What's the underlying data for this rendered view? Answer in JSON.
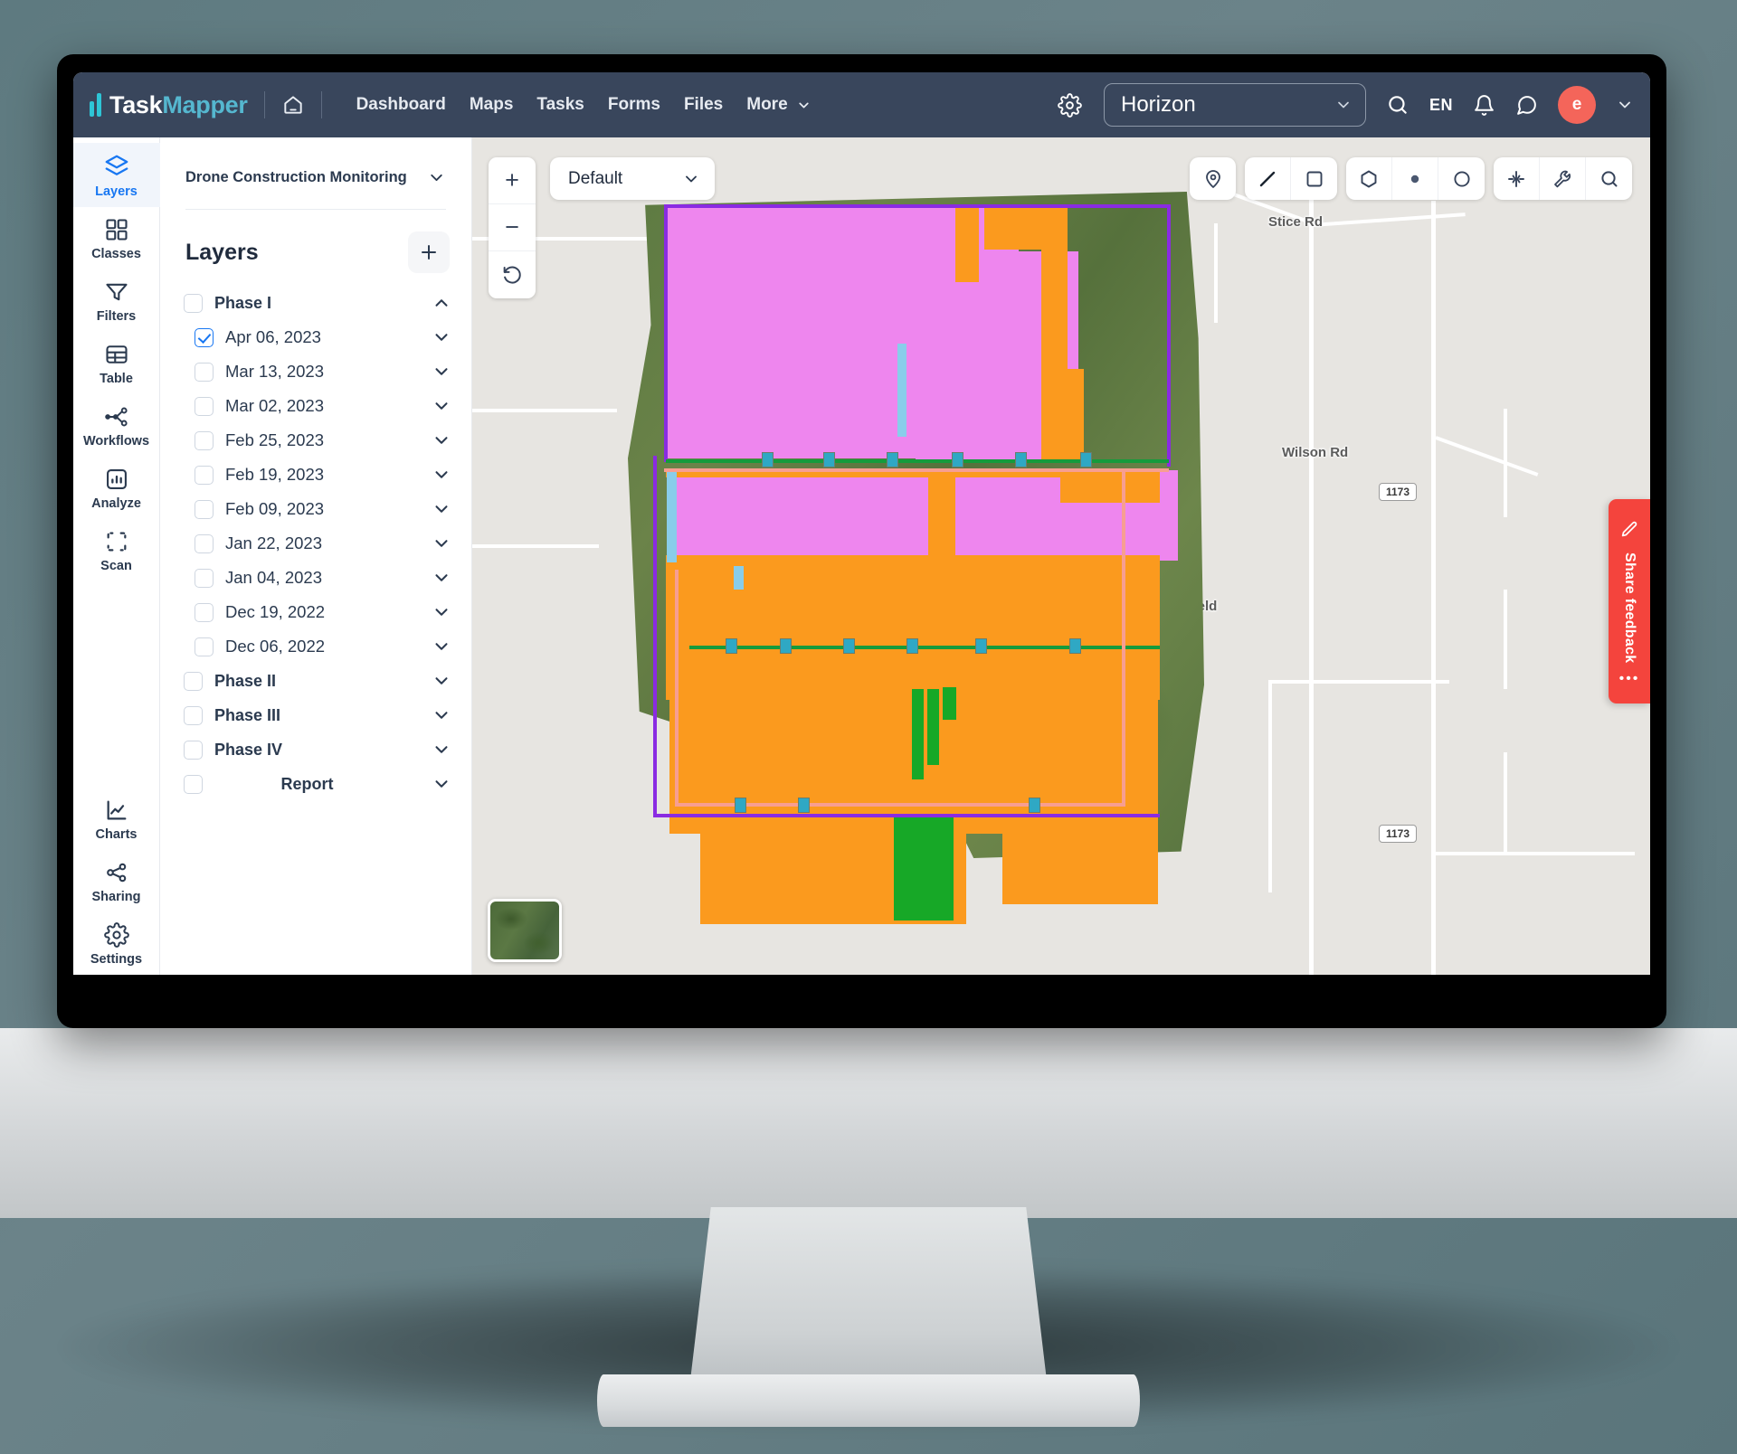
{
  "header": {
    "logo": {
      "primary": "Task",
      "secondary": "Mapper"
    },
    "home_icon": "home-icon",
    "nav": [
      {
        "label": "Dashboard"
      },
      {
        "label": "Maps"
      },
      {
        "label": "Tasks"
      },
      {
        "label": "Forms"
      },
      {
        "label": "Files"
      },
      {
        "label": "More"
      }
    ],
    "gear_icon": "gear-icon",
    "project_select": {
      "value": "Horizon",
      "chevron": "chevron-down-icon"
    },
    "search_icon": "search-icon",
    "language": "EN",
    "bell_icon": "bell-icon",
    "chat_icon": "chat-bubble-icon",
    "avatar": {
      "initial": "e",
      "color": "#f4655a"
    },
    "avatar_chevron": "chevron-down-icon"
  },
  "rail": {
    "items": [
      {
        "label": "Layers",
        "icon": "layers-icon",
        "active": true
      },
      {
        "label": "Classes",
        "icon": "grid-icon",
        "active": false
      },
      {
        "label": "Filters",
        "icon": "funnel-icon",
        "active": false
      },
      {
        "label": "Table",
        "icon": "table-icon",
        "active": false
      },
      {
        "label": "Workflows",
        "icon": "workflow-icon",
        "active": false
      },
      {
        "label": "Analyze",
        "icon": "analyze-chart-icon",
        "active": false
      },
      {
        "label": "Scan",
        "icon": "scan-icon",
        "active": false
      }
    ],
    "bottom_items": [
      {
        "label": "Charts",
        "icon": "line-chart-icon",
        "active": false
      },
      {
        "label": "Sharing",
        "icon": "share-icon",
        "active": false
      },
      {
        "label": "Settings",
        "icon": "settings-gear-icon",
        "active": false
      }
    ]
  },
  "panel": {
    "project_name": "Drone Construction Monitoring",
    "project_chevron": "chevron-down-icon",
    "title": "Layers",
    "add_label": "+",
    "layers": [
      {
        "label": "Phase I",
        "checked": false,
        "child": false,
        "chevron": "chevron-up-icon"
      },
      {
        "label": "Apr 06, 2023",
        "checked": true,
        "child": true,
        "chevron": "chevron-down-icon"
      },
      {
        "label": "Mar 13, 2023",
        "checked": false,
        "child": true,
        "chevron": "chevron-down-icon"
      },
      {
        "label": "Mar 02, 2023",
        "checked": false,
        "child": true,
        "chevron": "chevron-down-icon"
      },
      {
        "label": "Feb 25, 2023",
        "checked": false,
        "child": true,
        "chevron": "chevron-down-icon"
      },
      {
        "label": "Feb 19, 2023",
        "checked": false,
        "child": true,
        "chevron": "chevron-down-icon"
      },
      {
        "label": "Feb 09, 2023",
        "checked": false,
        "child": true,
        "chevron": "chevron-down-icon"
      },
      {
        "label": "Jan 22, 2023",
        "checked": false,
        "child": true,
        "chevron": "chevron-down-icon"
      },
      {
        "label": "Jan 04, 2023",
        "checked": false,
        "child": true,
        "chevron": "chevron-down-icon"
      },
      {
        "label": "Dec 19, 2022",
        "checked": false,
        "child": true,
        "chevron": "chevron-down-icon"
      },
      {
        "label": "Dec 06, 2022",
        "checked": false,
        "child": true,
        "chevron": "chevron-down-icon"
      },
      {
        "label": "Phase II",
        "checked": false,
        "child": false,
        "chevron": "chevron-down-icon"
      },
      {
        "label": "Phase III",
        "checked": false,
        "child": false,
        "chevron": "chevron-down-icon"
      },
      {
        "label": "Phase IV",
        "checked": false,
        "child": false,
        "chevron": "chevron-down-icon"
      },
      {
        "label": "Report",
        "checked": false,
        "child": false,
        "chevron": "chevron-down-icon"
      }
    ]
  },
  "map": {
    "zoom_in": "+",
    "zoom_out": "−",
    "reset_icon": "reset-rotation-icon",
    "basemap": {
      "value": "Default",
      "chevron": "chevron-down-icon"
    },
    "tools": [
      {
        "icon": "map-pin-icon"
      },
      {
        "icon": "line-draw-icon"
      },
      {
        "icon": "rectangle-draw-icon"
      },
      {
        "icon": "polygon-draw-icon"
      },
      {
        "icon": "point-draw-icon"
      },
      {
        "icon": "circle-draw-icon"
      },
      {
        "icon": "snap-icon"
      },
      {
        "icon": "wrench-icon"
      },
      {
        "icon": "map-search-icon"
      }
    ],
    "labels": [
      {
        "text": "Stice Rd"
      },
      {
        "text": "Wilson Rd"
      },
      {
        "text": "g Field"
      }
    ],
    "shields": [
      {
        "text": "1173"
      },
      {
        "text": "1173"
      }
    ],
    "minimap": "basemap-thumbnail",
    "overlay_colors": {
      "pink": "#ee86ee",
      "orange": "#fb9a1e",
      "green": "#17a827",
      "cyan": "#89cdea",
      "boundary_purple": "#8a2be2",
      "boundary_green": "#159b3c",
      "boundary_salmon": "#f79e91"
    }
  },
  "feedback": {
    "label": "Share feedback",
    "icon": "pencil-icon",
    "dots": "•••",
    "color": "#f4443d"
  }
}
